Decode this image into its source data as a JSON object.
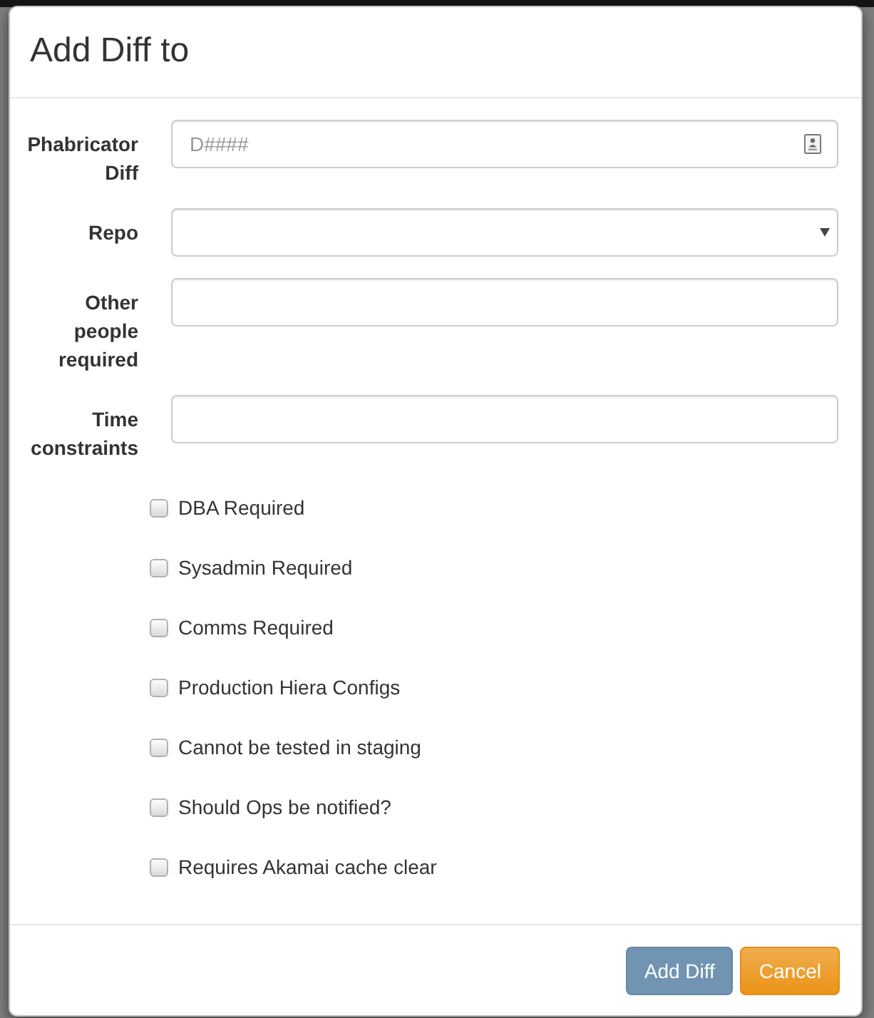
{
  "dialog": {
    "title": "Add Diff to"
  },
  "fields": [
    {
      "kind": "text",
      "label": "Phabricator Diff",
      "placeholder": "D####"
    },
    {
      "kind": "select",
      "label": "Repo"
    },
    {
      "kind": "text",
      "label": "Other people required"
    },
    {
      "kind": "text",
      "label": "Time constraints"
    }
  ],
  "checkboxes": [
    {
      "label": "DBA Required",
      "checked": false
    },
    {
      "label": "Sysadmin Required",
      "checked": false
    },
    {
      "label": "Comms Required",
      "checked": false
    },
    {
      "label": "Production Hiera Configs",
      "checked": false
    },
    {
      "label": "Cannot be tested in staging",
      "checked": false
    },
    {
      "label": "Should Ops be notified?",
      "checked": false
    },
    {
      "label": "Requires Akamai cache clear",
      "checked": false
    }
  ],
  "buttons": [
    {
      "kind": "primary",
      "label": "Add Diff"
    },
    {
      "kind": "warning",
      "label": "Cancel"
    }
  ]
}
